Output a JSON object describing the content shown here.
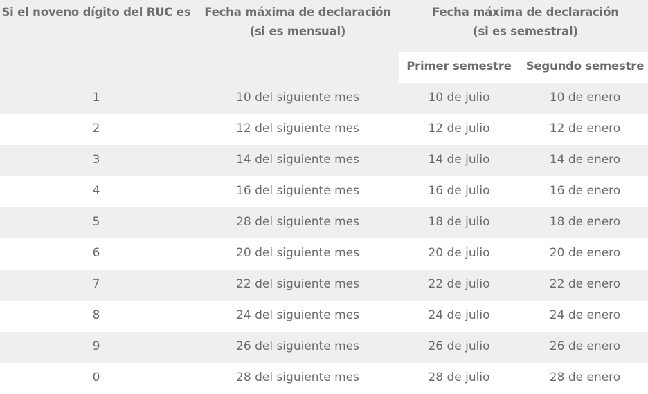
{
  "headers": {
    "ruc_digit": "Si el noveno dígito del RUC es",
    "monthly_line1": "Fecha máxima de declaración",
    "monthly_line2": "(si es mensual)",
    "semiannual_line1": "Fecha máxima de declaración",
    "semiannual_line2": "(si es semestral)",
    "first_semester": "Primer semestre",
    "second_semester": "Segundo semestre"
  },
  "rows": [
    {
      "digit": "1",
      "monthly": "10 del siguiente mes",
      "first": "10 de julio",
      "second": "10 de enero"
    },
    {
      "digit": "2",
      "monthly": "12 del siguiente mes",
      "first": "12 de julio",
      "second": "12 de enero"
    },
    {
      "digit": "3",
      "monthly": "14 del siguiente mes",
      "first": "14 de julio",
      "second": "14 de enero"
    },
    {
      "digit": "4",
      "monthly": "16 del siguiente mes",
      "first": "16 de julio",
      "second": "16 de enero"
    },
    {
      "digit": "5",
      "monthly": "28 del siguiente mes",
      "first": "18 de julio",
      "second": "18 de enero"
    },
    {
      "digit": "6",
      "monthly": "20 del siguiente mes",
      "first": "20 de julio",
      "second": "20 de enero"
    },
    {
      "digit": "7",
      "monthly": "22 del siguiente mes",
      "first": "22 de julio",
      "second": "22 de enero"
    },
    {
      "digit": "8",
      "monthly": "24 del siguiente mes",
      "first": "24 de julio",
      "second": "24 de enero"
    },
    {
      "digit": "9",
      "monthly": "26 del siguiente mes",
      "first": "26 de julio",
      "second": "26 de enero"
    },
    {
      "digit": "0",
      "monthly": "28 del siguiente mes",
      "first": "28 de julio",
      "second": "28 de enero"
    }
  ],
  "colors": {
    "shade": "#efefef",
    "text": "#6b6b6b"
  }
}
